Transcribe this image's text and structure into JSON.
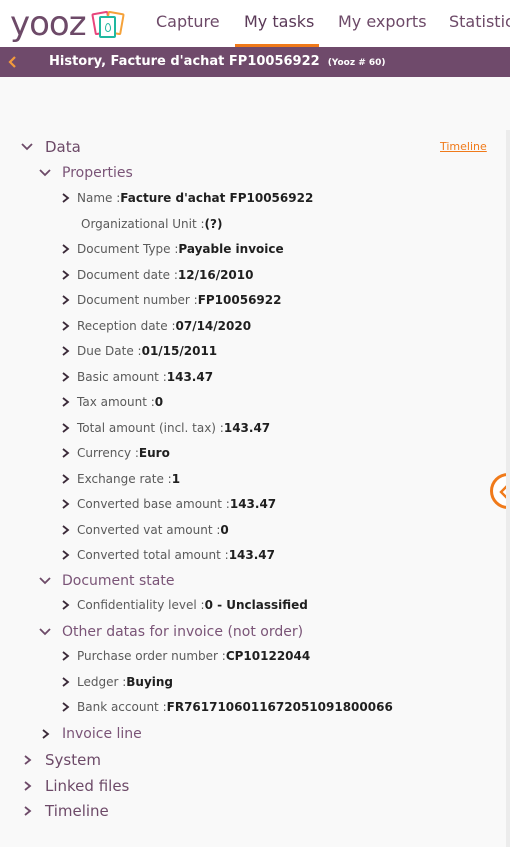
{
  "app": {
    "logo_text": "yooz",
    "brand_colors": {
      "primary": "#6f4a6b",
      "accent": "#f07a1a"
    }
  },
  "nav": {
    "tabs": [
      {
        "label": "Capture",
        "active": false
      },
      {
        "label": "My tasks",
        "active": true
      },
      {
        "label": "My exports",
        "active": false
      },
      {
        "label": "Statistics",
        "active": false
      }
    ]
  },
  "subbar": {
    "back_icon": "chevron-left-icon",
    "title": "History, Facture d'achat FP10056922",
    "doc_id": "(Yooz # 60)"
  },
  "timeline_link": "Timeline",
  "tree": {
    "data": {
      "label": "Data",
      "expanded": true,
      "properties": {
        "label": "Properties",
        "expanded": true,
        "items": [
          {
            "key": "Name : ",
            "value": "Facture d'achat FP10056922",
            "expandable": true
          },
          {
            "key": "Organizational Unit : ",
            "value": "(?)",
            "expandable": false
          },
          {
            "key": "Document Type : ",
            "value": "Payable invoice",
            "expandable": true
          },
          {
            "key": "Document date : ",
            "value": "12/16/2010",
            "expandable": true
          },
          {
            "key": "Document number : ",
            "value": "FP10056922",
            "expandable": true
          },
          {
            "key": "Reception date : ",
            "value": "07/14/2020",
            "expandable": true
          },
          {
            "key": "Due Date : ",
            "value": "01/15/2011",
            "expandable": true
          },
          {
            "key": "Basic amount : ",
            "value": "143.47",
            "expandable": true
          },
          {
            "key": "Tax amount : ",
            "value": "0",
            "expandable": true
          },
          {
            "key": "Total amount (incl. tax) : ",
            "value": "143.47",
            "expandable": true
          },
          {
            "key": "Currency : ",
            "value": "Euro",
            "expandable": true
          },
          {
            "key": "Exchange rate : ",
            "value": "1",
            "expandable": true
          },
          {
            "key": "Converted base amount : ",
            "value": "143.47",
            "expandable": true
          },
          {
            "key": "Converted vat amount : ",
            "value": "0",
            "expandable": true
          },
          {
            "key": "Converted total amount : ",
            "value": "143.47",
            "expandable": true
          }
        ]
      },
      "document_state": {
        "label": "Document state",
        "expanded": true,
        "items": [
          {
            "key": "Confidentiality level : ",
            "value": "0 - Unclassified",
            "expandable": true
          }
        ]
      },
      "other_datas": {
        "label": "Other datas for invoice (not order)",
        "expanded": true,
        "items": [
          {
            "key": "Purchase order number : ",
            "value": "CP10122044",
            "expandable": true
          },
          {
            "key": "Ledger : ",
            "value": "Buying",
            "expandable": true
          },
          {
            "key": "Bank account : ",
            "value": "FR7617106011672051091800066",
            "expandable": true
          }
        ]
      },
      "invoice_line": {
        "label": "Invoice line",
        "expanded": false
      }
    },
    "system": {
      "label": "System",
      "expanded": false
    },
    "linked_files": {
      "label": "Linked files",
      "expanded": false
    },
    "timeline": {
      "label": "Timeline",
      "expanded": false
    }
  },
  "side_panel_toggle": {
    "icon": "chevron-left-icon"
  }
}
